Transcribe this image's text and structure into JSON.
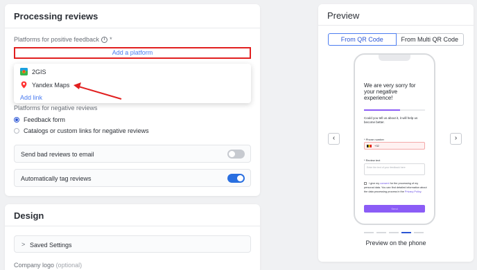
{
  "processing": {
    "title": "Processing reviews",
    "positive_label": "Platforms for positive feedback",
    "required_mark": "*",
    "add_platform": "Add a platform",
    "dropdown": {
      "items": [
        {
          "label": "2GIS",
          "icon": "2gis-icon"
        },
        {
          "label": "Yandex Maps",
          "icon": "map-pin-icon"
        }
      ],
      "add_link": "Add link"
    },
    "negative_label": "Platforms for negative reviews",
    "negative_options": [
      {
        "label": "Feedback form",
        "selected": true
      },
      {
        "label": "Catalogs or custom links for negative reviews",
        "selected": false
      }
    ],
    "toggles": [
      {
        "label": "Send bad reviews to email",
        "on": false
      },
      {
        "label": "Automatically tag reviews",
        "on": true
      }
    ]
  },
  "design": {
    "title": "Design",
    "saved_settings": "Saved Settings",
    "company_logo": "Company logo",
    "optional": "(optional)"
  },
  "preview": {
    "title": "Preview",
    "tabs": [
      "From QR Code",
      "From Multi QR Code"
    ],
    "active_tab": 0,
    "phone": {
      "title": "We are very sorry for your negative experience!",
      "subtitle": "Could you tell us about it, it will help us become better.",
      "phone_label": "* Phone number",
      "phone_code": "+32",
      "review_label": "* Review text",
      "review_placeholder": "Enter the text of your feedback here",
      "consent_prefix": "I give my",
      "consent_link": "consent",
      "consent_middle": "for the processing of my personal data. You can find detailed information about the data processing process in the",
      "privacy_link": "Privacy Policy",
      "consent_suffix": ".",
      "send": "Send"
    },
    "slide_count": 5,
    "active_slide": 3,
    "caption": "Preview on the phone"
  },
  "colors": {
    "accent": "#2a55d4",
    "link": "#4b7cf0",
    "highlight_red": "#e11f1f",
    "phone_accent": "#8b5cf6"
  }
}
